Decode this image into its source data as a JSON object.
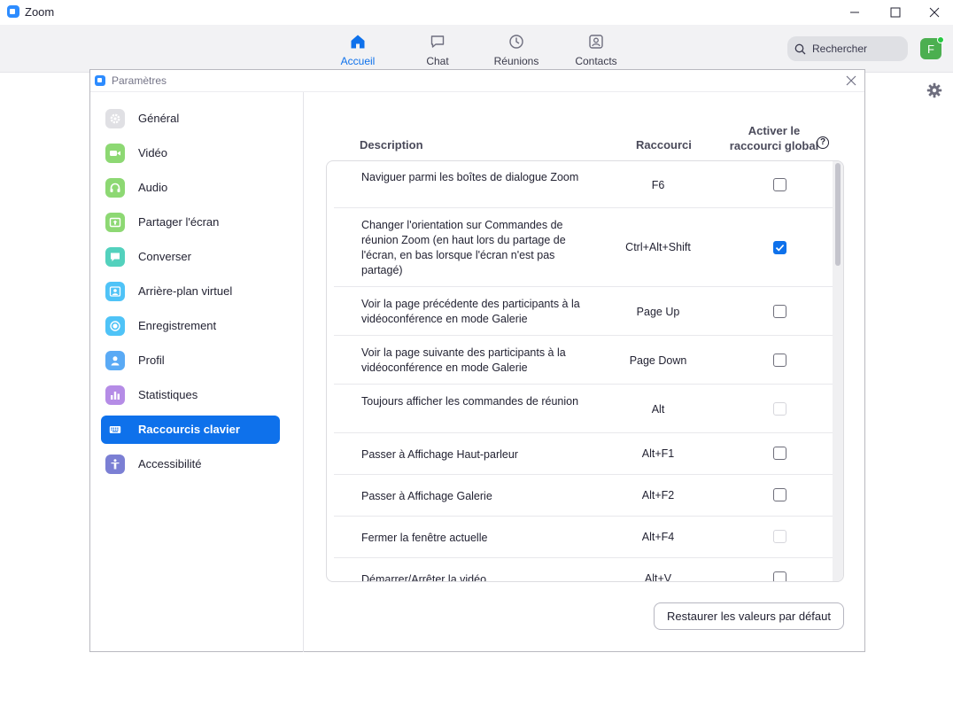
{
  "app": {
    "title": "Zoom"
  },
  "nav": {
    "tabs": [
      {
        "label": "Accueil",
        "icon": "home-icon",
        "active": true
      },
      {
        "label": "Chat",
        "icon": "chat-icon"
      },
      {
        "label": "Réunions",
        "icon": "clock-icon"
      },
      {
        "label": "Contacts",
        "icon": "contacts-icon"
      }
    ],
    "search_label": "Rechercher",
    "avatar_initial": "F"
  },
  "dialog": {
    "title": "Paramètres",
    "sidebar": [
      {
        "label": "Général",
        "icon": "gear-icon",
        "color": "#e0e0e4"
      },
      {
        "label": "Vidéo",
        "icon": "video-icon",
        "color": "#8dd873"
      },
      {
        "label": "Audio",
        "icon": "headphones-icon",
        "color": "#8dd873"
      },
      {
        "label": "Partager l'écran",
        "icon": "share-screen-icon",
        "color": "#8dd873"
      },
      {
        "label": "Converser",
        "icon": "chat-bubble-icon",
        "color": "#53d1bd"
      },
      {
        "label": "Arrière-plan virtuel",
        "icon": "person-background-icon",
        "color": "#4fc3f7"
      },
      {
        "label": "Enregistrement",
        "icon": "record-icon",
        "color": "#4fc3f7"
      },
      {
        "label": "Profil",
        "icon": "profile-icon",
        "color": "#5aaaf5"
      },
      {
        "label": "Statistiques",
        "icon": "bar-chart-icon",
        "color": "#b58ce6"
      },
      {
        "label": "Raccourcis clavier",
        "icon": "keyboard-icon",
        "active": true
      },
      {
        "label": "Accessibilité",
        "icon": "accessibility-icon",
        "color": "#7b7fd4"
      }
    ],
    "shortcuts": {
      "col_description": "Description",
      "col_shortcut": "Raccourci",
      "col_global_line1": "Activer le",
      "col_global_line2": "raccourci global",
      "rows": [
        {
          "description": "Naviguer parmi les boîtes de dialogue Zoom",
          "key": "F6",
          "global": "unchecked"
        },
        {
          "description": "Changer l'orientation sur Commandes de réunion Zoom (en haut lors du partage de l'écran, en bas lorsque l'écran n'est pas partagé)",
          "key": "Ctrl+Alt+Shift",
          "global": "checked"
        },
        {
          "description": "Voir la page précédente des participants à la vidéoconférence en mode Galerie",
          "key": "Page Up",
          "global": "unchecked"
        },
        {
          "description": "Voir la page suivante des participants à la vidéoconférence en mode Galerie",
          "key": "Page Down",
          "global": "unchecked"
        },
        {
          "description": "Toujours afficher les commandes de réunion",
          "key": "Alt",
          "global": "disabled"
        },
        {
          "description": "Passer à Affichage Haut-parleur",
          "key": "Alt+F1",
          "global": "unchecked"
        },
        {
          "description": "Passer à Affichage Galerie",
          "key": "Alt+F2",
          "global": "unchecked"
        },
        {
          "description": "Fermer la fenêtre actuelle",
          "key": "Alt+F4",
          "global": "disabled"
        },
        {
          "description": "Démarrer/Arrêter la vidéo",
          "key": "Alt+V",
          "global": "unchecked"
        }
      ]
    },
    "restore_button": "Restaurer les valeurs par défaut"
  },
  "colors": {
    "accent": "#0E71EB",
    "brand": "#2D8CFF"
  }
}
